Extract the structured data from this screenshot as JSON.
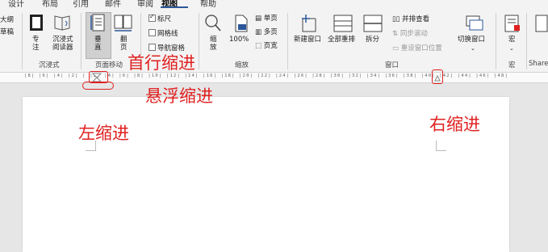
{
  "tabs": [
    "设计",
    "布局",
    "引用",
    "邮件",
    "审阅",
    "视图",
    "帮助"
  ],
  "active_tab": "视图",
  "ribbon": {
    "views_partial": [
      "大纲",
      "草稿"
    ],
    "immersive": {
      "focus": "专\n注",
      "reader": "沉浸式\n阅读器",
      "group": "沉浸式"
    },
    "page_movement": {
      "vertical": "垂\n直",
      "side": "翻\n页",
      "group": "页面移动"
    },
    "show": {
      "ruler": "标尺",
      "gridlines": "网格线",
      "nav_pane": "导航窗格",
      "ruler_checked": true,
      "gridlines_checked": false,
      "nav_checked": false
    },
    "zoom": {
      "zoom": "缩\n放",
      "percent": "100%",
      "one_page": "单页",
      "multi_page": "多页",
      "page_width": "页宽",
      "group": "缩放"
    },
    "window": {
      "new_window": "新建窗口",
      "arrange_all": "全部重排",
      "split": "拆分",
      "side_by_side": "并排查看",
      "sync_scroll": "同步滚动",
      "reset_pos": "重设窗口位置",
      "switch": "切换窗口",
      "group": "窗口"
    },
    "macros": {
      "label": "宏",
      "group": "宏"
    },
    "share_partial": "Share"
  },
  "ruler": {
    "ticks": "|8| |6| |4| |2| | |2| |4| |6| |8| |10| |12| |14| |16| |18| |20| |22| |24| |26| |28| |30| |32| |34| |36| |38| |40| |42| |44| |46| |48|"
  },
  "annotations": {
    "first_line_indent": "首行缩进",
    "hanging_indent": "悬浮缩进",
    "left_indent": "左缩进",
    "right_indent": "右缩进"
  },
  "colors": {
    "annotation": "#e02020",
    "accent": "#2b579a"
  }
}
